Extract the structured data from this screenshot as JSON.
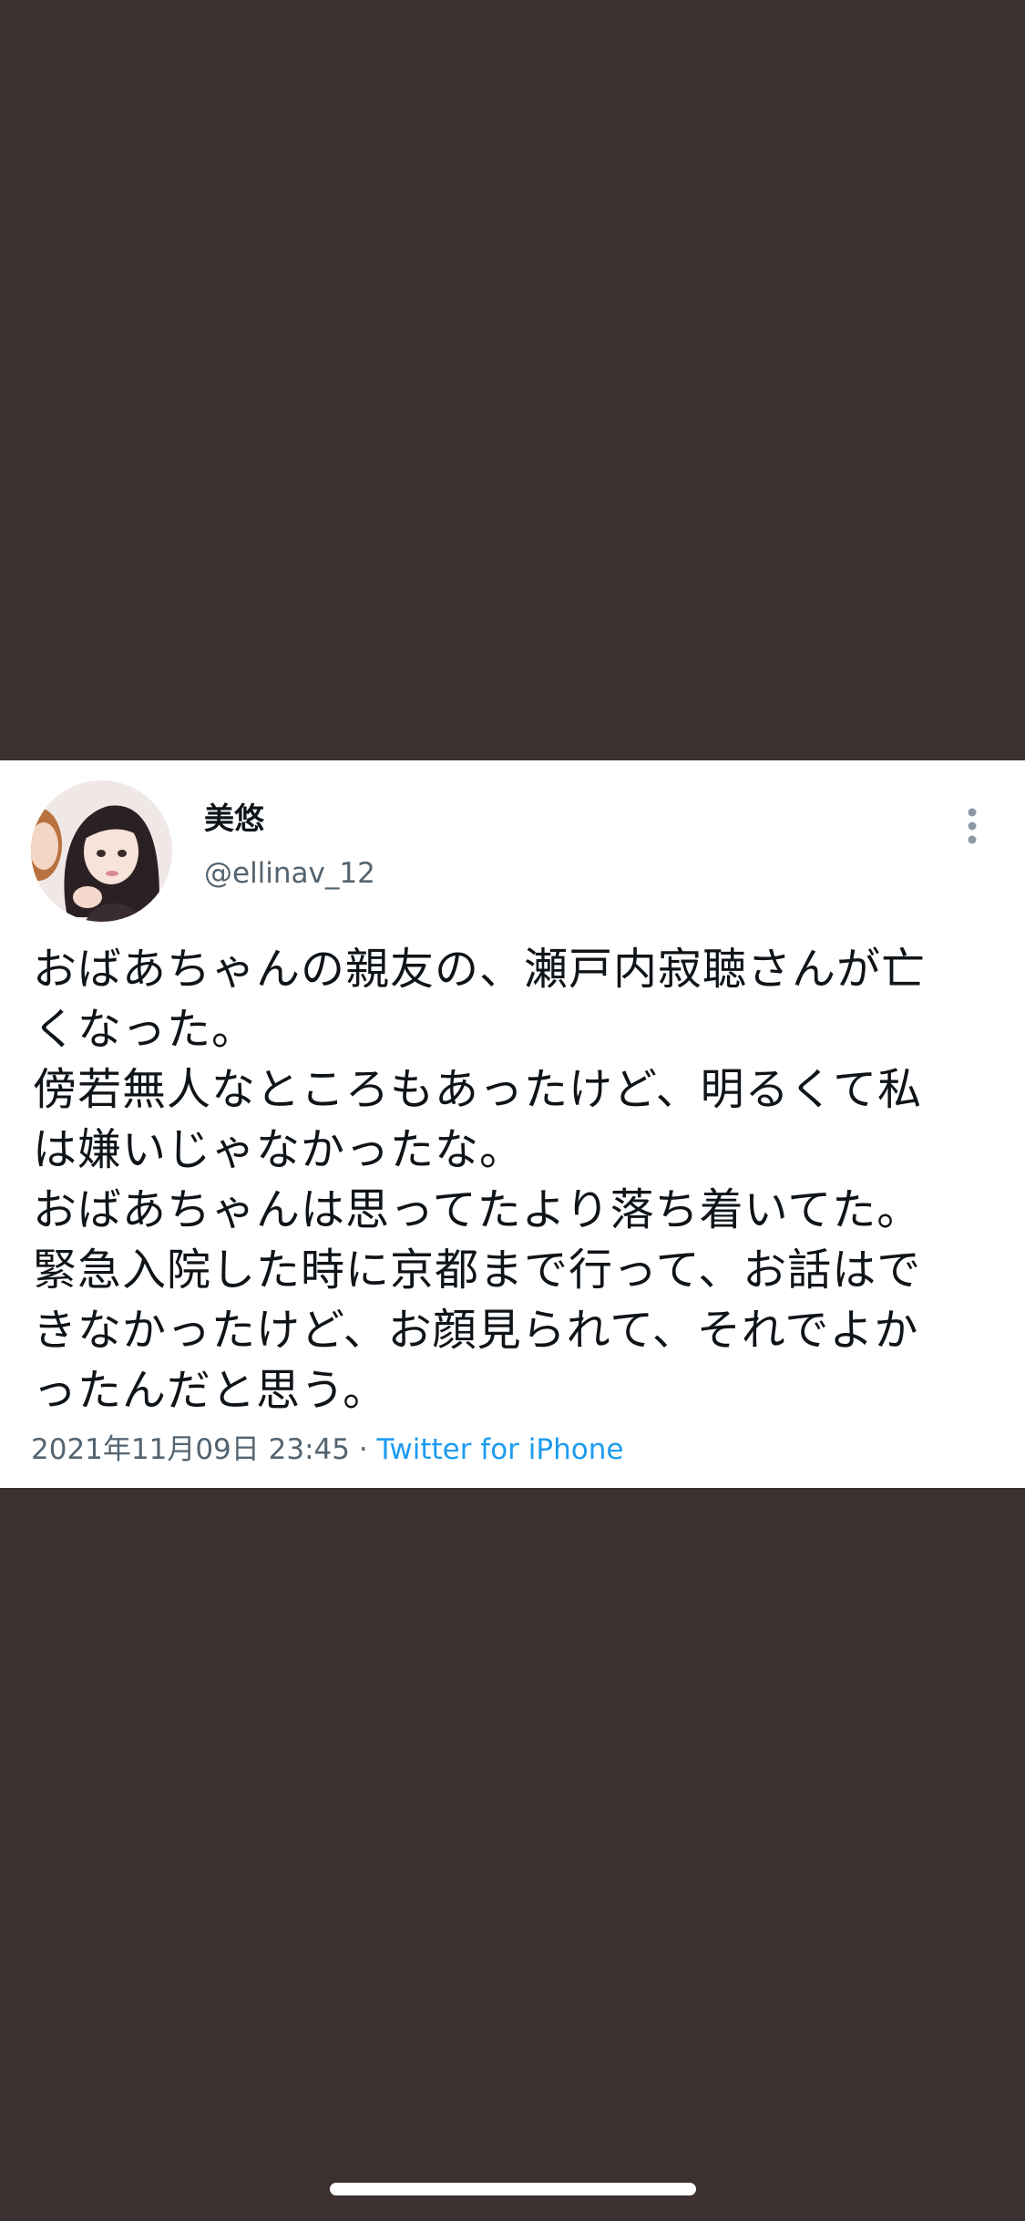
{
  "tweet": {
    "author": {
      "display_name": "美悠",
      "handle": "@ellinav_12",
      "avatar_icon": "profile-photo"
    },
    "more_icon": "more-vertical-icon",
    "text_lines": [
      "おばあちゃんの親友の、瀬戸内寂聴さんが亡",
      "くなった。",
      "傍若無人なところもあったけど、明るくて私",
      "は嫌いじゃなかったな。",
      "おばあちゃんは思ってたより落ち着いてた。",
      "緊急入院した時に京都まで行って、お話はで",
      "きなかったけど、お顔見られて、それでよか",
      "ったんだと思う。"
    ],
    "timestamp": "2021年11月09日 23:45",
    "separator": " · ",
    "source": "Twitter for iPhone"
  },
  "colors": {
    "background": "#3c3031",
    "card": "#ffffff",
    "text": "#0f1419",
    "secondary": "#536471",
    "link": "#1d9bf0"
  }
}
